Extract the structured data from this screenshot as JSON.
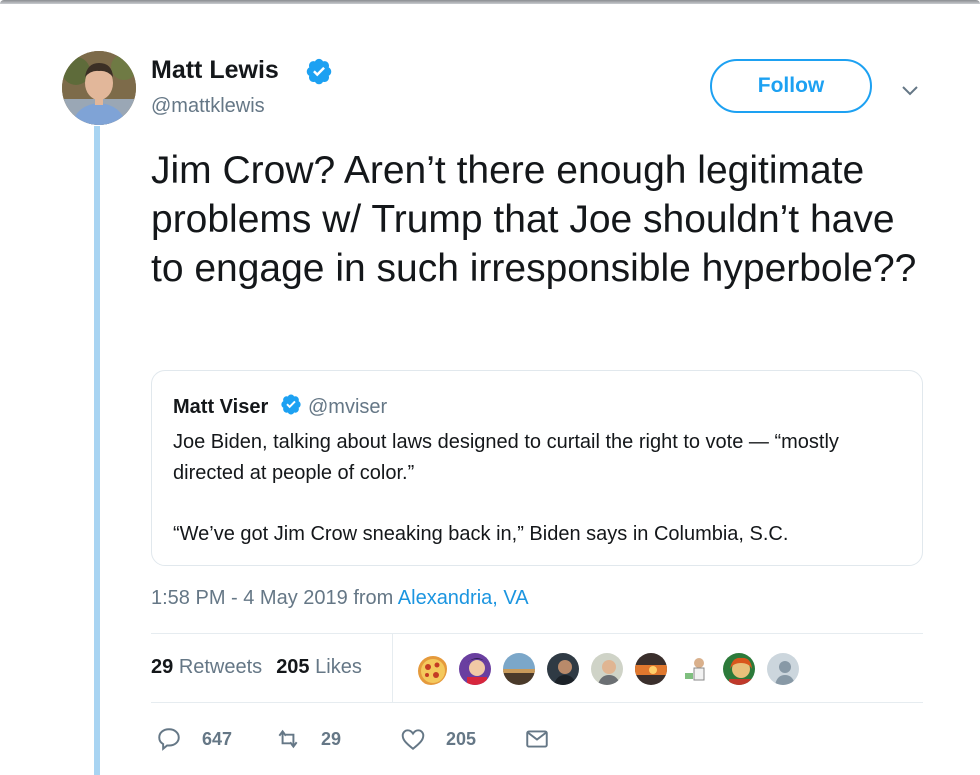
{
  "author": {
    "name": "Matt Lewis",
    "handle": "@mattklewis"
  },
  "follow_button": {
    "label": "Follow"
  },
  "tweet": {
    "text": "Jim Crow? Aren’t there enough legitimate problems w/ Trump that Joe shouldn’t have to engage in such irresponsible hyperbole??"
  },
  "quoted_tweet": {
    "name": "Matt Viser",
    "handle": "@mviser",
    "text_line1": "Joe Biden, talking about laws designed to curtail the right to vote — “mostly directed at people of color.”",
    "text_line2": "“We’ve got Jim Crow sneaking back in,” Biden says in Columbia, S.C."
  },
  "meta": {
    "time_date": "1:58 PM - 4 May 2019 from ",
    "location": "Alexandria, VA"
  },
  "stats": {
    "retweets_count": "29",
    "retweets_label": "Retweets",
    "likes_count": "205",
    "likes_label": "Likes"
  },
  "actions": {
    "replies": "647",
    "retweets": "29",
    "likes": "205"
  },
  "colors": {
    "accent": "#1da1f2",
    "link": "#1b95e0",
    "secondary_text": "#657786",
    "thread_line": "#a8d4f2"
  },
  "icons": {
    "verified": "verified-badge-icon",
    "caret": "chevron-down-icon",
    "reply": "reply-icon",
    "retweet": "retweet-icon",
    "like": "heart-icon",
    "dm": "envelope-icon"
  }
}
